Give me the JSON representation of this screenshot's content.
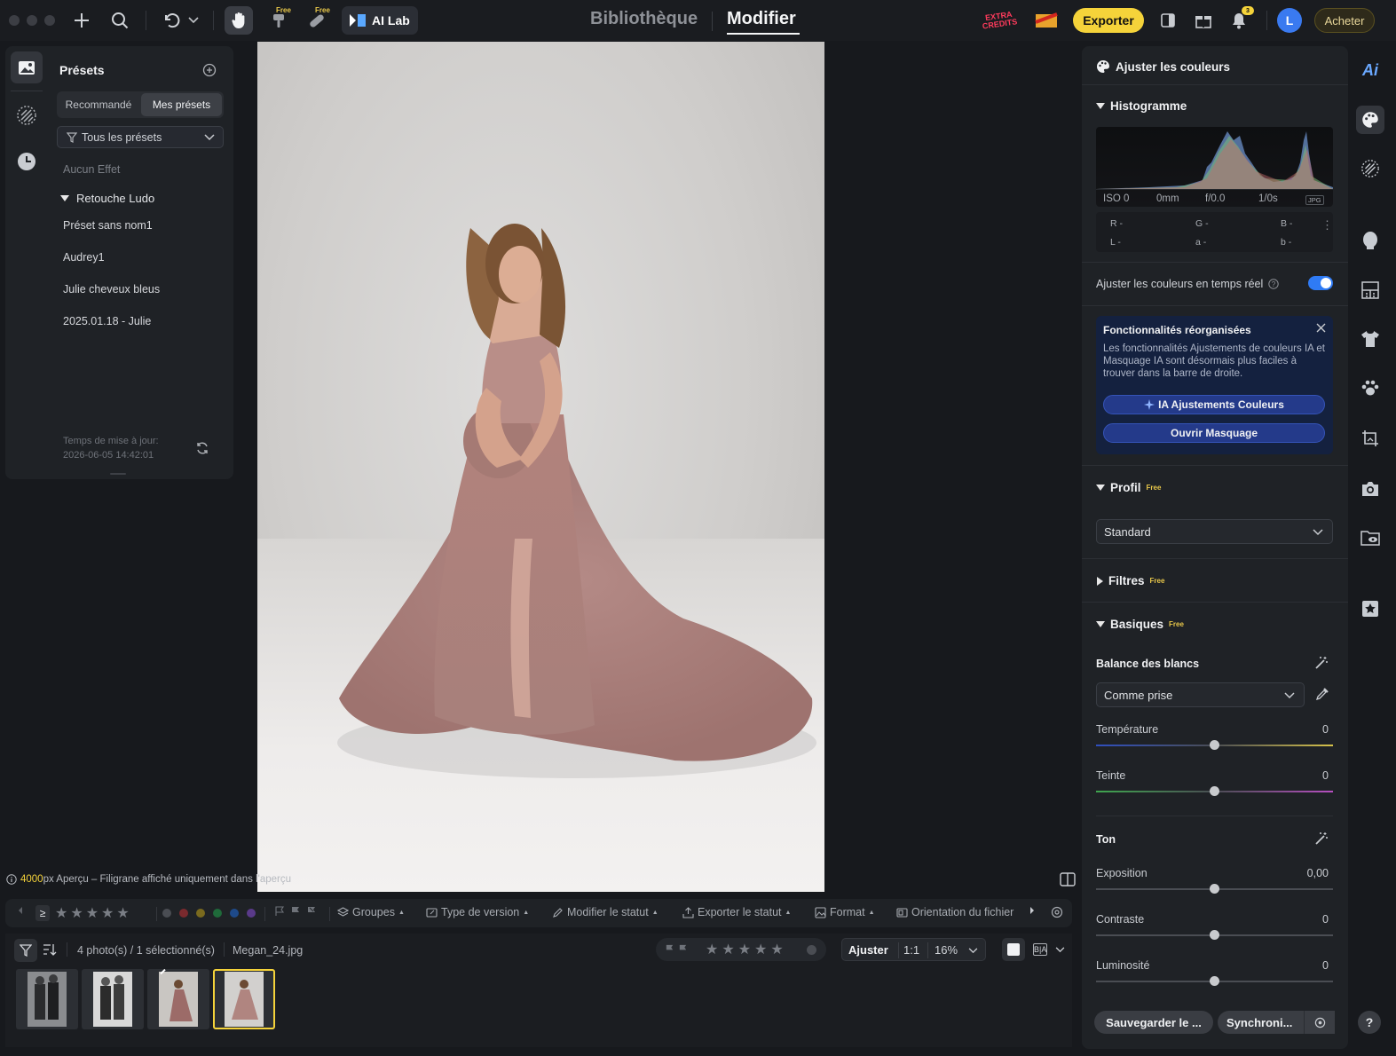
{
  "topbar": {
    "ai_lab_label": "AI Lab",
    "free_tag": "Free",
    "tab_library": "Bibliothèque",
    "tab_edit": "Modifier",
    "extra_credits": "EXTRA CREDITS",
    "export_label": "Exporter",
    "notif_count": "3",
    "avatar_letter": "L",
    "buy_label": "Acheter"
  },
  "presets": {
    "title": "Présets",
    "tab_recommended": "Recommandé",
    "tab_mine": "Mes présets",
    "filter_value": "Tous les présets",
    "no_effect": "Aucun Effet",
    "group_name": "Retouche Ludo",
    "items": [
      "Préset sans nom1",
      "Audrey1",
      "Julie cheveux bleus",
      "2025.01.18 - Julie"
    ],
    "update_label": "Temps de mise à jour:",
    "update_time": "2026-06-05 14:42:01"
  },
  "canvas": {
    "preview_px": "4000",
    "preview_note": "px Aperçu – Filigrane affiché uniquement dans l'aperçu"
  },
  "toolbar": {
    "groups": "Groupes",
    "version_type": "Type de version",
    "modify_status": "Modifier le statut",
    "export_status": "Exporter le statut",
    "format": "Format",
    "file_orientation": "Orientation du fichier",
    "label_colors": [
      "#7a2a2e",
      "#7a6a1e",
      "#1f6a3a",
      "#1e4a8a",
      "#5a3a8a"
    ]
  },
  "filmstrip": {
    "count": "4 photo(s) / 1 sélectionné(s)",
    "filename": "Megan_24.jpg",
    "adjust": "Ajuster",
    "one_to_one": "1:1",
    "zoom": "16%"
  },
  "panel": {
    "title": "Ajuster les couleurs",
    "histogram_title": "Histogramme",
    "exif": {
      "iso": "ISO 0",
      "focal": "0mm",
      "aperture": "f/0.0",
      "shutter": "1/0s",
      "format": "JPG"
    },
    "rgb": {
      "r": "R -",
      "g": "G -",
      "b": "B -",
      "l": "L -",
      "a": "a -",
      "b2": "b -"
    },
    "realtime_label": "Ajuster les couleurs en temps réel",
    "realtime_on": true,
    "notice_title": "Fonctionnalités réorganisées",
    "notice_body": "Les fonctionnalités Ajustements de couleurs IA et Masquage IA sont désormais plus faciles à trouver dans la barre de droite.",
    "notice_btn1": "IA Ajustements Couleurs",
    "notice_btn2": "Ouvrir Masquage",
    "profile_title": "Profil",
    "profile_value": "Standard",
    "filters_title": "Filtres",
    "basics_title": "Basiques",
    "free_tag": "Free",
    "wb_title": "Balance des blancs",
    "wb_value": "Comme prise",
    "temperature_label": "Température",
    "temperature_value": "0",
    "tint_label": "Teinte",
    "tint_value": "0",
    "tone_title": "Ton",
    "exposure_label": "Exposition",
    "exposure_value": "0,00",
    "contrast_label": "Contraste",
    "contrast_value": "0",
    "brightness_label": "Luminosité",
    "brightness_value": "0",
    "save_btn": "Sauvegarder le ...",
    "sync_btn": "Synchroni..."
  },
  "rail_right": {
    "ai_label": "Ai",
    "help": "?"
  }
}
